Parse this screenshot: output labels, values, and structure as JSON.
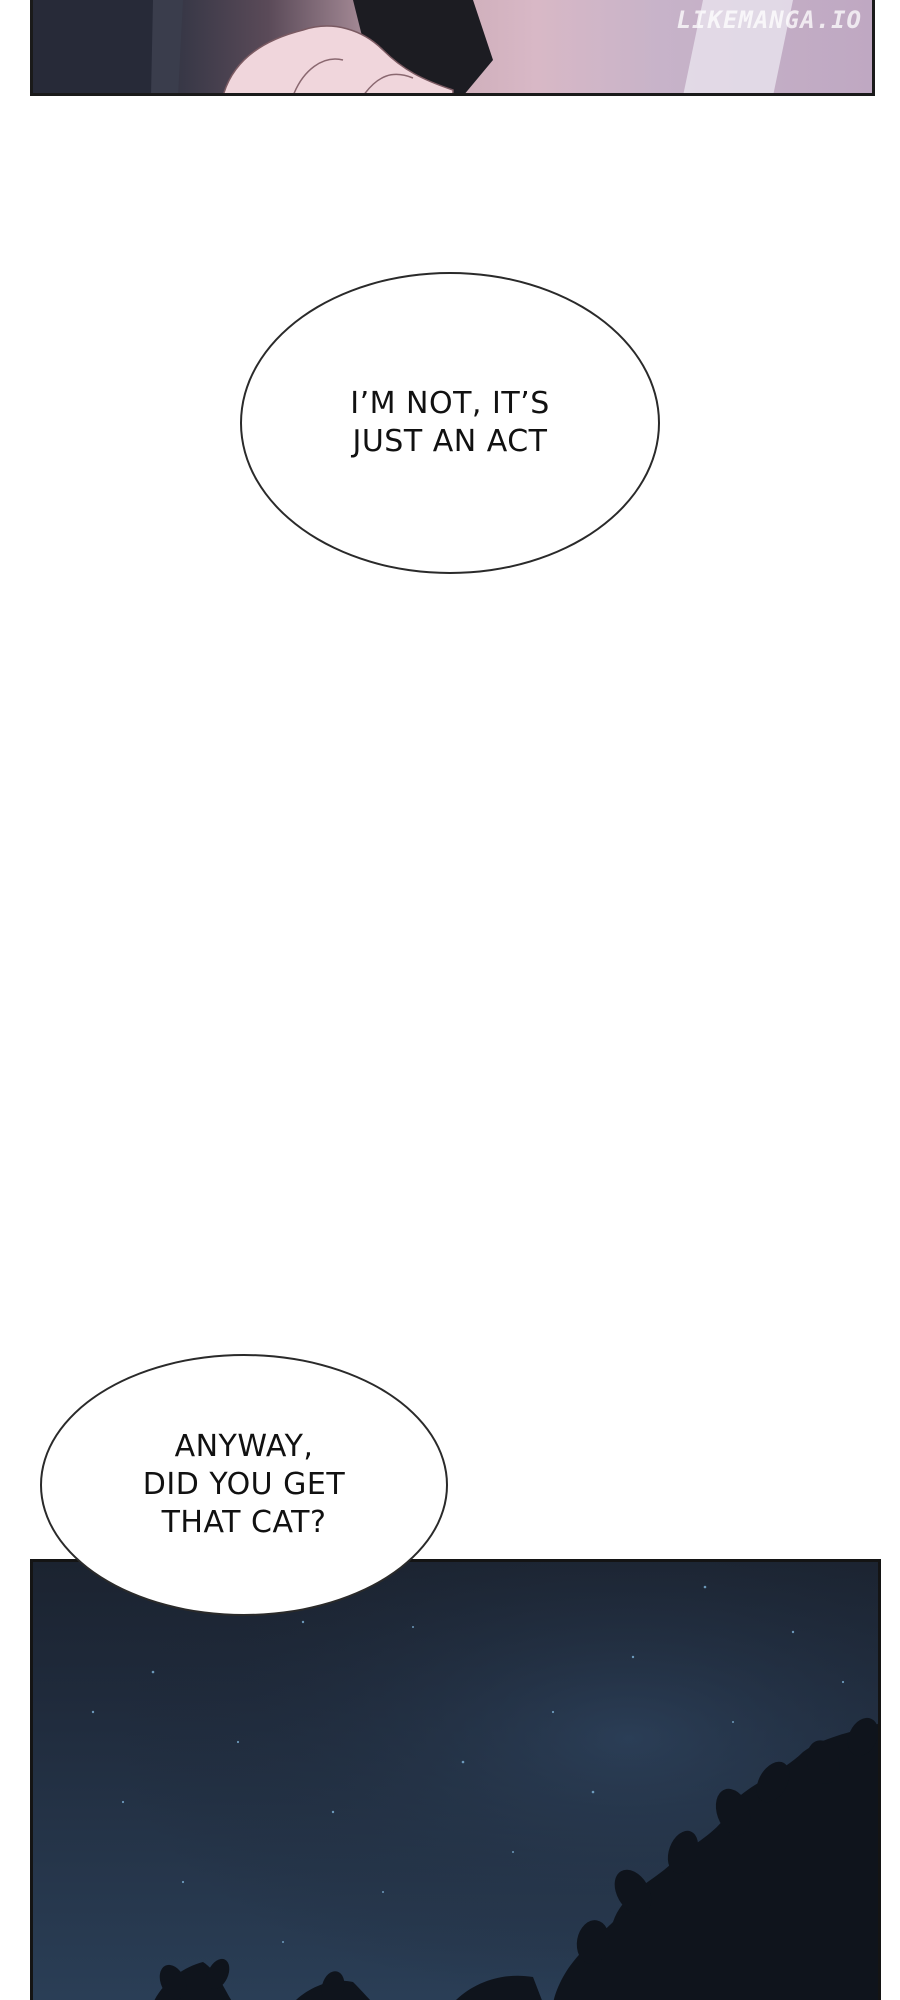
{
  "watermark": "LIKEMANGA.IO",
  "bubbles": [
    {
      "text": "I’M NOT, IT’S\nJUST AN ACT"
    },
    {
      "text": "ANYWAY,\nDID YOU GET\nTHAT CAT?"
    }
  ],
  "colors": {
    "page_background": "#ffffff",
    "panel_border": "#1a1a1a",
    "night_sky": "#1f2a3b",
    "foliage": "#0f141c"
  }
}
